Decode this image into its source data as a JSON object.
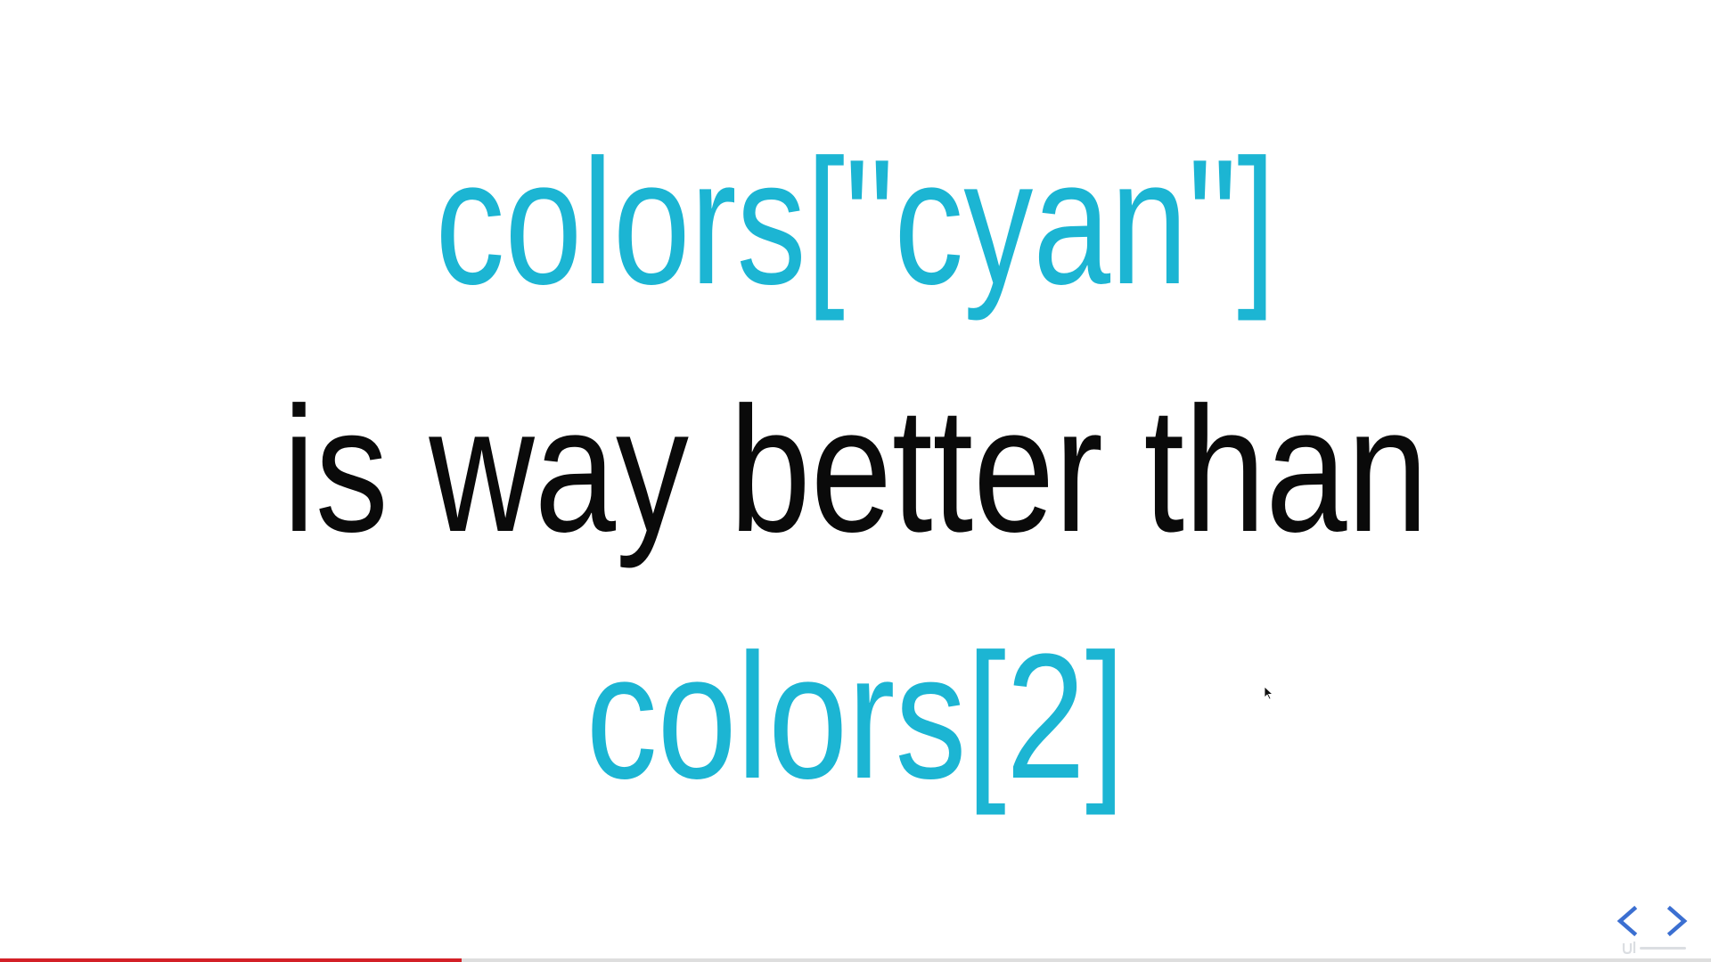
{
  "slide": {
    "line1": "colors[\"cyan\"]",
    "line2": "is way better than",
    "line3": "colors[2]"
  },
  "colors": {
    "accent": "#1cb5d3",
    "body_text": "#0a0a0a",
    "progress": "#d32027",
    "nav": "#3b6fd1"
  },
  "progress": {
    "fraction": 0.27
  },
  "navigation": {
    "prev_icon": "chevron-left-icon",
    "next_icon": "chevron-right-icon"
  }
}
